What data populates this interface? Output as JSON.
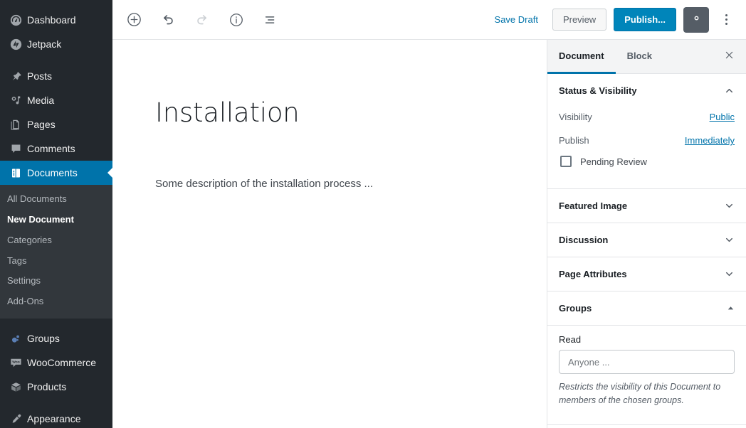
{
  "sidebar": {
    "items": [
      {
        "label": "Dashboard",
        "icon": "dashboard-icon",
        "name": "dashboard"
      },
      {
        "label": "Jetpack",
        "icon": "jetpack-icon",
        "name": "jetpack"
      },
      {
        "label": "Posts",
        "icon": "pin-icon",
        "name": "posts"
      },
      {
        "label": "Media",
        "icon": "media-icon",
        "name": "media"
      },
      {
        "label": "Pages",
        "icon": "pages-icon",
        "name": "pages"
      },
      {
        "label": "Comments",
        "icon": "comment-icon",
        "name": "comments"
      },
      {
        "label": "Documents",
        "icon": "documents-icon",
        "name": "documents"
      },
      {
        "label": "Groups",
        "icon": "groups-icon",
        "name": "groups"
      },
      {
        "label": "WooCommerce",
        "icon": "woocommerce-icon",
        "name": "woocommerce"
      },
      {
        "label": "Products",
        "icon": "products-icon",
        "name": "products"
      },
      {
        "label": "Appearance",
        "icon": "appearance-icon",
        "name": "appearance"
      }
    ],
    "submenu": [
      {
        "label": "All Documents",
        "current": false
      },
      {
        "label": "New Document",
        "current": true
      },
      {
        "label": "Categories",
        "current": false
      },
      {
        "label": "Tags",
        "current": false
      },
      {
        "label": "Settings",
        "current": false
      },
      {
        "label": "Add-Ons",
        "current": false
      }
    ],
    "active_item": "Documents",
    "colors": {
      "bg": "#23282d",
      "submenu_bg": "#32373c",
      "active": "#0073aa"
    }
  },
  "toolbar": {
    "add_block_label": "Add block",
    "undo_label": "Undo",
    "redo_label": "Redo",
    "info_label": "Content structure",
    "list_view_label": "Block navigation",
    "save_draft_label": "Save Draft",
    "preview_label": "Preview",
    "publish_label": "Publish...",
    "settings_label": "Settings",
    "more_label": "More tools & options",
    "publish_color": "#0085ba"
  },
  "editor": {
    "title": "Installation",
    "body": "Some description of the installation process ..."
  },
  "panel": {
    "tabs": [
      {
        "label": "Document",
        "active": true
      },
      {
        "label": "Block",
        "active": false
      }
    ],
    "close_label": "Close settings",
    "sections": {
      "status": {
        "title": "Status & Visibility",
        "visibility_label": "Visibility",
        "visibility_value": "Public",
        "publish_label": "Publish",
        "publish_value": "Immediately",
        "pending_review_label": "Pending Review"
      },
      "featured_image": {
        "title": "Featured Image"
      },
      "discussion": {
        "title": "Discussion"
      },
      "page_attributes": {
        "title": "Page Attributes"
      },
      "groups": {
        "title": "Groups",
        "read_label": "Read",
        "read_placeholder": "Anyone ...",
        "help_text": "Restricts the visibility of this Document to members of the chosen groups."
      }
    }
  }
}
